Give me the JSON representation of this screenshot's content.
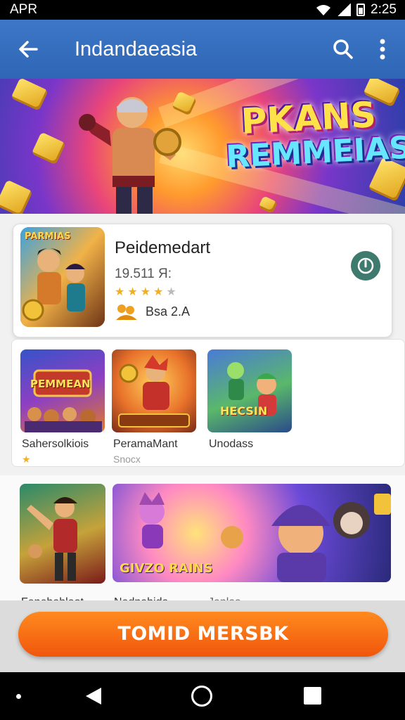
{
  "status_bar": {
    "carrier": "APR",
    "time": "2:25"
  },
  "app_bar": {
    "title": "Indandaeasia"
  },
  "banner": {
    "title_line1": "PKANS",
    "title_line2": "REMMEIAS"
  },
  "featured": {
    "thumb_text": "PARMIAS",
    "name": "Peidemedart",
    "meta": "19.511 Я:",
    "rating_stars": 3.5,
    "author": "Bsa 2.A",
    "install_color": "#3f7a6e"
  },
  "row1": [
    {
      "label": "Sahersolkiois",
      "sub": "",
      "art_text": "PEMMEAN"
    },
    {
      "label": "PeramaMant",
      "sub": "Snocx",
      "art_text": ""
    },
    {
      "label": "Unodass",
      "sub": "",
      "art_text": "HECSIN"
    }
  ],
  "row2": [
    {
      "label": "Fenebahlaot",
      "art_text": ""
    },
    {
      "label": "Nednahida",
      "art_text": "GIVZO RAINS"
    },
    {
      "label": "Janlas",
      "art_text": ""
    }
  ],
  "cta": {
    "label": "TOMID MERSBK",
    "color": "#f0560c"
  },
  "colors": {
    "app_bar": "#2f66b6",
    "accent": "#ff8a1e"
  }
}
